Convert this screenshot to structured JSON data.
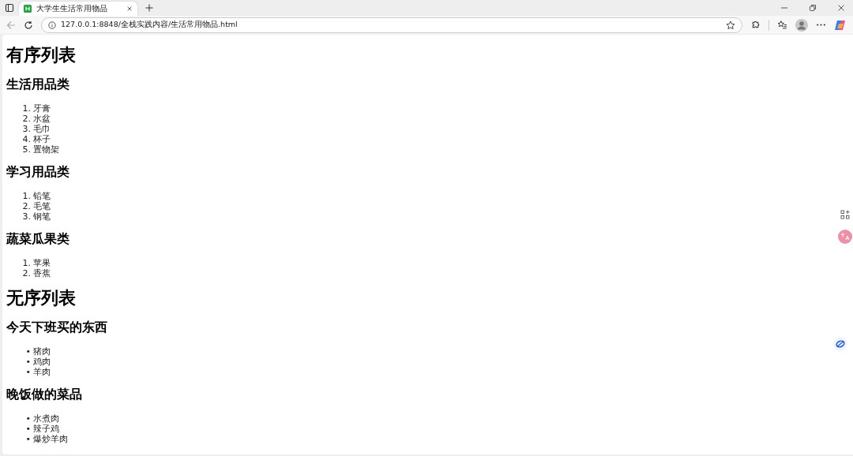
{
  "browser": {
    "tabs": [
      {
        "title": "大学生生活常用物品",
        "selected": true
      }
    ],
    "address": "127.0.0.1:8848/全栈实践内容/生活常用物品.html"
  },
  "page": {
    "sections": [
      {
        "title": "有序列表",
        "groups": [
          {
            "title": "生活用品类",
            "items": [
              {
                "marker": "1.",
                "text": "牙膏"
              },
              {
                "marker": "2.",
                "text": "水盆"
              },
              {
                "marker": "3.",
                "text": "毛巾"
              },
              {
                "marker": "4.",
                "text": "杯子"
              },
              {
                "marker": "5.",
                "text": "置物架"
              }
            ]
          },
          {
            "title": "学习用品类",
            "items": [
              {
                "marker": "1.",
                "text": "铅笔"
              },
              {
                "marker": "2.",
                "text": "毛笔"
              },
              {
                "marker": "3.",
                "text": "钢笔"
              }
            ]
          },
          {
            "title": "蔬菜瓜果类",
            "items": [
              {
                "marker": "1.",
                "text": "苹果"
              },
              {
                "marker": "2.",
                "text": "香蕉"
              }
            ]
          }
        ]
      },
      {
        "title": "无序列表",
        "groups": [
          {
            "title": "今天下班买的东西",
            "items": [
              {
                "marker": "•",
                "text": "猪肉"
              },
              {
                "marker": "•",
                "text": "鸡肉"
              },
              {
                "marker": "•",
                "text": "羊肉"
              }
            ]
          },
          {
            "title": "晚饭做的菜品",
            "items": [
              {
                "marker": "•",
                "text": "水煮肉"
              },
              {
                "marker": "•",
                "text": "辣子鸡"
              },
              {
                "marker": "•",
                "text": "爆炒羊肉"
              }
            ]
          }
        ]
      }
    ]
  }
}
